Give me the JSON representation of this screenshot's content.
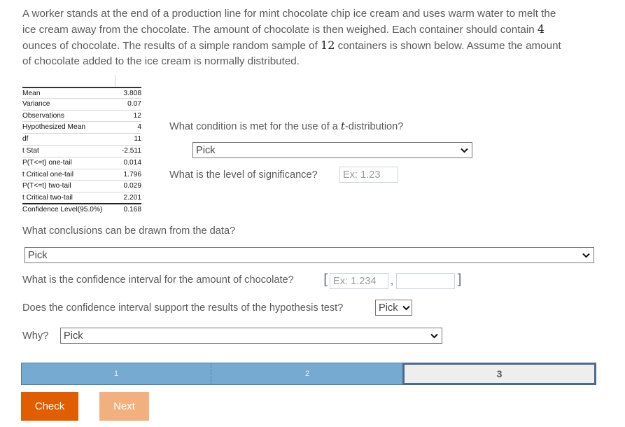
{
  "prompt": {
    "line1": "A worker stands at the end of a production line for mint chocolate chip ice cream and uses warm water to melt the",
    "line2_pre": "ice cream away from the chocolate. The amount of chocolate is then weighed. Each container should contain ",
    "line2_num": "4",
    "line3_pre": "ounces of chocolate. The results of a simple random sample of ",
    "line3_num": "12",
    "line3_post": " containers is shown below. Assume the amount",
    "line4": "of chocolate added to the ice cream is normally distributed."
  },
  "stats_table": {
    "rows": [
      {
        "label": "Mean",
        "value": "3.808"
      },
      {
        "label": "Variance",
        "value": "0.07"
      },
      {
        "label": "Observations",
        "value": "12"
      },
      {
        "label": "Hypothesized Mean",
        "value": "4"
      },
      {
        "label": "df",
        "value": "11"
      },
      {
        "label": "t Stat",
        "value": "-2.511"
      },
      {
        "label": "P(T<=t) one-tail",
        "value": "0.014"
      },
      {
        "label": "t Critical one-tail",
        "value": "1.796"
      },
      {
        "label": "P(T<=t) two-tail",
        "value": "0.029"
      },
      {
        "label": "t Critical two-tail",
        "value": "2.201"
      },
      {
        "label": "Confidence Level(95.0%)",
        "value": "0.168"
      }
    ]
  },
  "questions": {
    "condition": {
      "pre": "What condition is met for the use of a ",
      "var": "t",
      "post": "-distribution?",
      "selected": "Pick"
    },
    "significance": {
      "label": "What is the level of significance?",
      "placeholder": "Ex: 1.23"
    },
    "conclusions": {
      "label": "What conclusions can be drawn from the data?",
      "selected": "Pick"
    },
    "interval": {
      "label": "What is the confidence interval for the amount of chocolate?",
      "open": "[",
      "placeholder_low": "Ex: 1.234",
      "separator": ",",
      "placeholder_high": "",
      "close": "]"
    },
    "support": {
      "label": "Does the confidence interval support the results of the hypothesis test?",
      "selected": "Pick"
    },
    "why": {
      "label": "Why?",
      "selected": "Pick"
    }
  },
  "progress": {
    "segments": [
      {
        "label": "1",
        "state": "done"
      },
      {
        "label": "2",
        "state": "done"
      },
      {
        "label": "3",
        "state": "current"
      }
    ],
    "colors": {
      "done": "#77aad1",
      "current_border": "#4c6a8c"
    }
  },
  "buttons": {
    "check": "Check",
    "next": "Next",
    "colors": {
      "check": "#e05d00",
      "next": "#f2b07f"
    }
  }
}
